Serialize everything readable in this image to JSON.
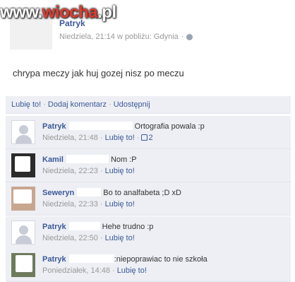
{
  "watermark": {
    "prefix": "www.",
    "accent": "wiocha",
    "suffix": ".pl"
  },
  "post": {
    "author": "Patryk",
    "meta": "Niedziela, 21:14 w pobliżu: Gdynia",
    "text": "chrypa meczy jak huj gozej nisz po meczu"
  },
  "actions": {
    "like": "Lubię to!",
    "comment": "Dodaj komentarz",
    "share": "Udostępnij"
  },
  "comments": [
    {
      "name": "Patryk",
      "text": "Ortografia powala :p",
      "time": "Niedziela, 21:48",
      "like": "Lubię to!",
      "like_count": "2",
      "avatar": "silhouette"
    },
    {
      "name": "Kamil",
      "text": "Nom :P",
      "time": "Niedziela, 22:23",
      "like": "Lubię to!",
      "avatar": "photo-dark"
    },
    {
      "name": "Seweryn",
      "text": "Bo to analfabeta ;D xD",
      "time": "Niedziela, 22:33",
      "like": "Lubię to!",
      "avatar": "photo-light"
    },
    {
      "name": "Patryk",
      "text": "Hehe trudno :p",
      "time": "Niedziela, 22:50",
      "like": "Lubię to!",
      "avatar": "silhouette"
    },
    {
      "name": "Patryk",
      "text": ":niepoprawiac to nie szkoła",
      "time": "Poniedziałek, 14:48",
      "like": "Lubię to!",
      "avatar": "photo-mixed"
    }
  ],
  "colors": {
    "link": "#3b5998",
    "comment_bg": "#edeff4",
    "meta": "#999999"
  }
}
